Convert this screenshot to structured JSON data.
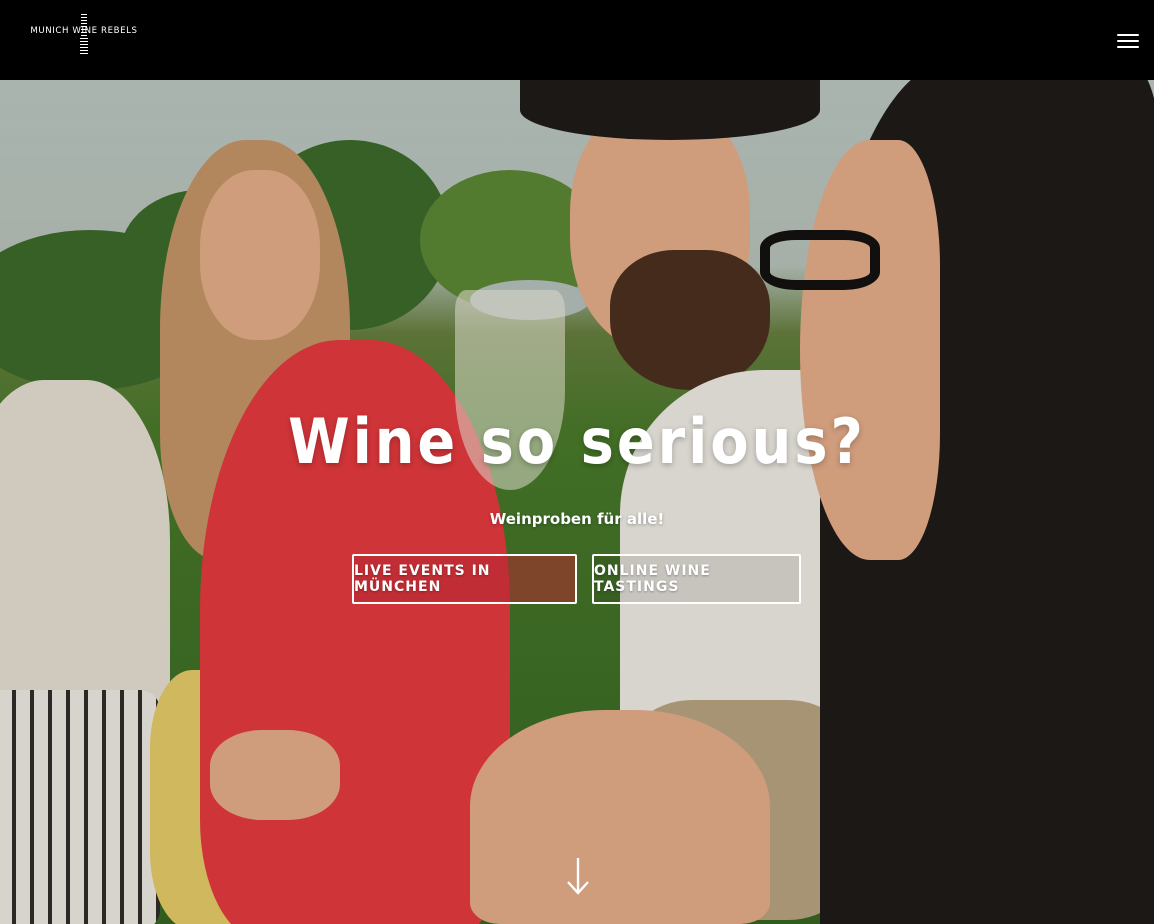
{
  "header": {
    "logo_text": "MUNICH WINE REBELS",
    "menu_icon": "hamburger-menu-icon"
  },
  "hero": {
    "title": "Wine so serious?",
    "subtitle": "Weinproben für alle!",
    "buttons": [
      {
        "label": "Live Events in München"
      },
      {
        "label": "Online Wine Tastings"
      }
    ],
    "scroll_icon": "arrow-down-icon"
  },
  "colors": {
    "topbar": "#000000",
    "text": "#ffffff",
    "dress_red": "#e8393f"
  }
}
